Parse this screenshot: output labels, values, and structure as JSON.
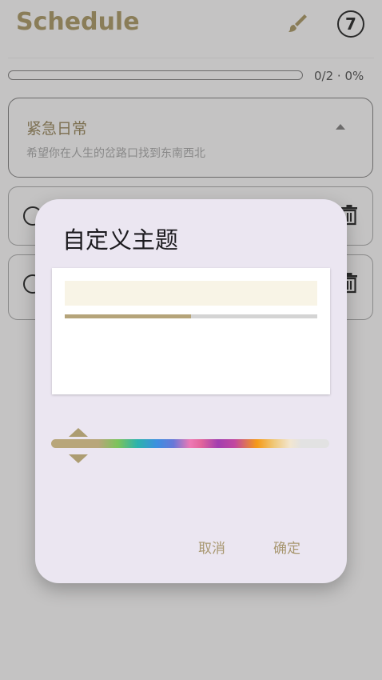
{
  "app": {
    "title": "Schedule",
    "badge_count": "7",
    "progress": {
      "text": "0/2 · 0%",
      "fraction": 0
    },
    "group": {
      "title": "紧急日常",
      "subtitle": "希望你在人生的岔路口找到东南西北"
    },
    "icons": {
      "brush": "brush-icon",
      "trash": "trash-icon",
      "collapse": "chevron-up-icon"
    },
    "colors": {
      "accent": "#8a7d58",
      "dim_background": "#c4c3c3"
    }
  },
  "dialog": {
    "title": "自定义主题",
    "preview": {
      "fill_fraction": 0.5,
      "bar_color": "#f8f4e6",
      "fill_color": "#b5a47a"
    },
    "slider": {
      "selected_color": "#b8a67a",
      "position_fraction": 0.1
    },
    "cancel_label": "取消",
    "confirm_label": "确定",
    "colors": {
      "surface": "#ebe6f1",
      "button_text": "#a89770"
    }
  }
}
